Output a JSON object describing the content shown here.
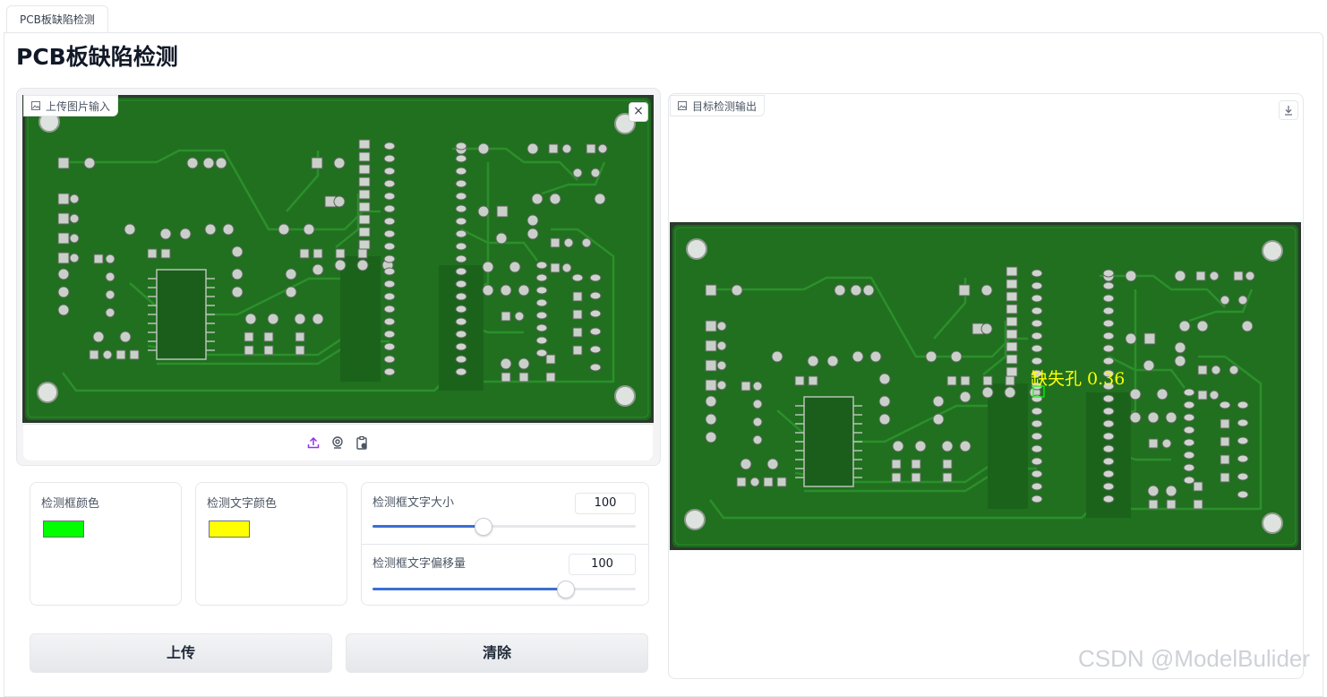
{
  "tab": {
    "label": "PCB板缺陷检测"
  },
  "page": {
    "title": "PCB板缺陷检测"
  },
  "upload_panel": {
    "label": "上传图片输入",
    "close": "×"
  },
  "output_panel": {
    "label": "目标检测输出"
  },
  "detection": {
    "label": "缺失孔 0.36"
  },
  "controls": {
    "box_color": {
      "label": "检测框颜色",
      "value": "#00ff00"
    },
    "text_color": {
      "label": "检测文字颜色",
      "value": "#ffff00"
    },
    "text_size": {
      "label": "检测框文字大小",
      "value": "100",
      "fraction": 0.42
    },
    "text_offset": {
      "label": "检测框文字偏移量",
      "value": "100",
      "fraction": 0.73
    }
  },
  "buttons": {
    "upload": "上传",
    "clear": "清除"
  },
  "watermark": "CSDN @ModelBulider",
  "icons": {
    "panel": "image-icon",
    "upload": "upload-icon",
    "webcam": "webcam-icon",
    "clipboard": "clipboard-icon",
    "download": "download-icon"
  },
  "colors": {
    "accent": "#3b6fd4",
    "pcb": "#1f6e1f"
  }
}
